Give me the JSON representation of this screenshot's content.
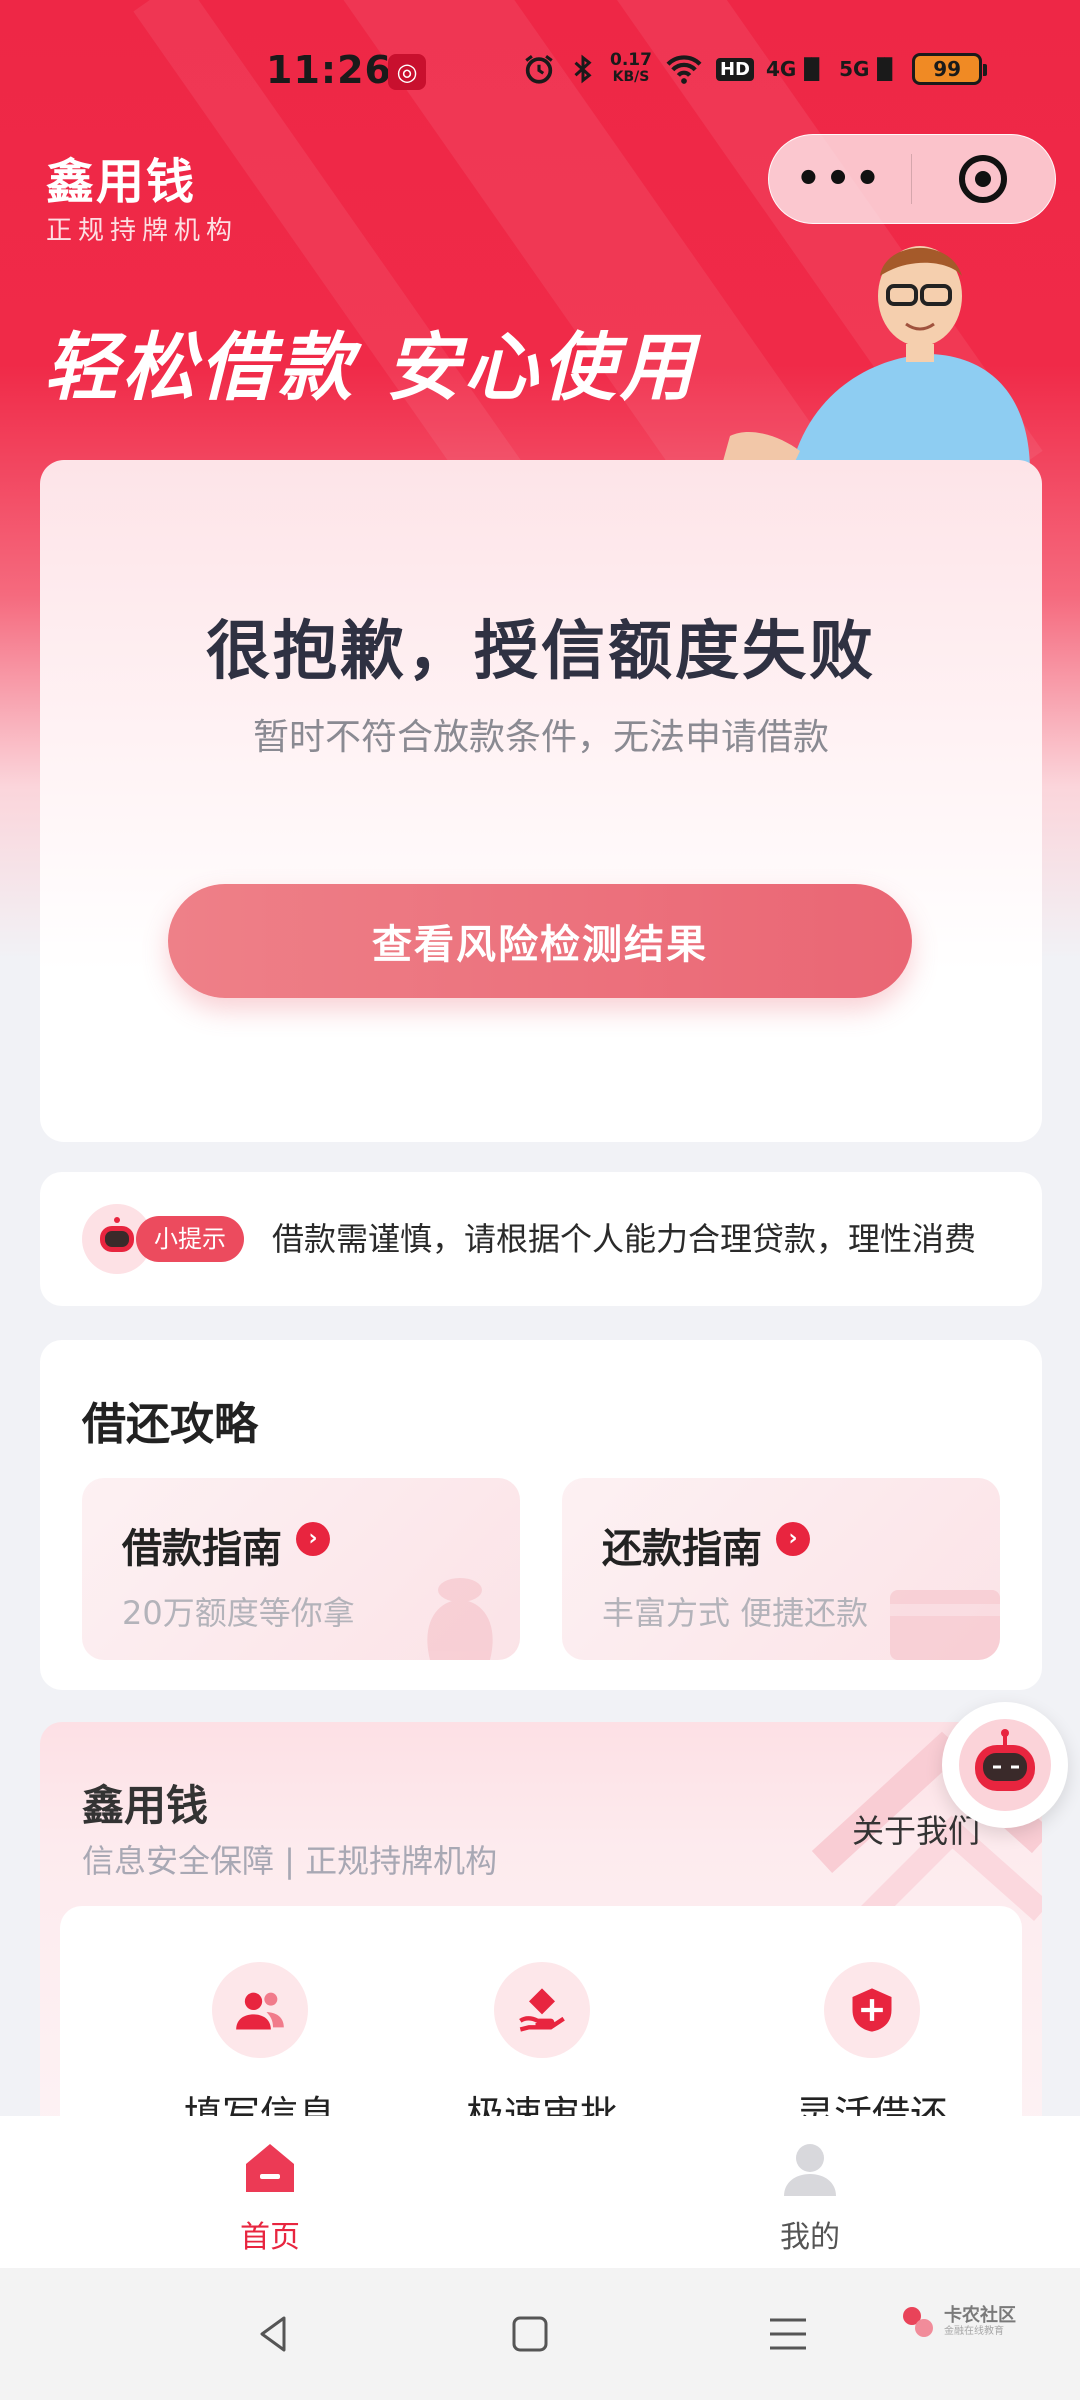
{
  "status_bar": {
    "time": "11:26",
    "speed": "0.17",
    "speed_unit": "KB/S",
    "hd": "HD",
    "net1": "4G",
    "net2": "5G",
    "battery": "99"
  },
  "header": {
    "title": "鑫用钱",
    "subtitle": "正规持牌机构",
    "slogan": "轻松借款  安心使用"
  },
  "result_card": {
    "headline": "很抱歉，授信额度失败",
    "subline": "暂时不符合放款条件，无法申请借款",
    "cta_label": "查看风险检测结果"
  },
  "tip": {
    "badge": "小提示",
    "text": "借款需谨慎，请根据个人能力合理贷款，理性消费"
  },
  "guide": {
    "title": "借还攻略",
    "tiles": [
      {
        "title": "借款指南",
        "subtitle": "20万额度等你拿"
      },
      {
        "title": "还款指南",
        "subtitle": "丰富方式 便捷还款"
      }
    ]
  },
  "about": {
    "title": "鑫用钱",
    "subtitle": "信息安全保障  |  正规持牌机构",
    "link": "关于我们",
    "features": [
      {
        "label": "填写信息",
        "icon": "users-icon"
      },
      {
        "label": "极速审批",
        "icon": "hand-diamond-icon"
      },
      {
        "label": "灵活借还",
        "icon": "shield-icon"
      }
    ]
  },
  "tab_bar": {
    "home": "首页",
    "mine": "我的"
  },
  "watermark": {
    "main": "卡农社区",
    "sub": "金融在线教育"
  },
  "colors": {
    "brand_red": "#ee2746",
    "cta": "#ea6674",
    "active_tab": "#e8253f"
  }
}
